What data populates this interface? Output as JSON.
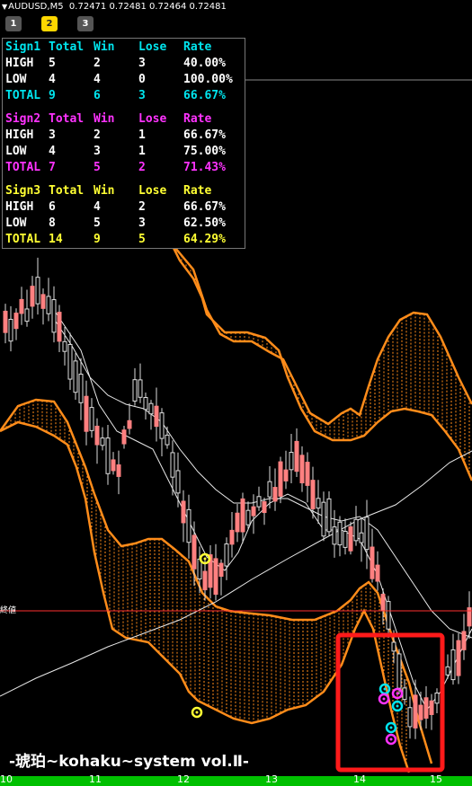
{
  "header": {
    "symbol": "AUDUSD,M5",
    "quotes": "0.72471 0.72481 0.72464 0.72481"
  },
  "tabs": [
    {
      "label": "1",
      "active": false
    },
    {
      "label": "2",
      "active": true
    },
    {
      "label": "3",
      "active": false
    }
  ],
  "stats": {
    "sign1": {
      "header": [
        "Sign1",
        "Total",
        "Win",
        "Lose",
        "Rate"
      ],
      "rows": [
        [
          "HIGH",
          "5",
          "2",
          "3",
          "40.00%"
        ],
        [
          "LOW",
          "4",
          "4",
          "0",
          "100.00%"
        ],
        [
          "TOTAL",
          "9",
          "6",
          "3",
          "66.67%"
        ]
      ]
    },
    "sign2": {
      "header": [
        "Sign2",
        "Total",
        "Win",
        "Lose",
        "Rate"
      ],
      "rows": [
        [
          "HIGH",
          "3",
          "2",
          "1",
          "66.67%"
        ],
        [
          "LOW",
          "4",
          "3",
          "1",
          "75.00%"
        ],
        [
          "TOTAL",
          "7",
          "5",
          "2",
          "71.43%"
        ]
      ]
    },
    "sign3": {
      "header": [
        "Sign3",
        "Total",
        "Win",
        "Lose",
        "Rate"
      ],
      "rows": [
        [
          "HIGH",
          "6",
          "4",
          "2",
          "66.67%"
        ],
        [
          "LOW",
          "8",
          "5",
          "3",
          "62.50%"
        ],
        [
          "TOTAL",
          "14",
          "9",
          "5",
          "64.29%"
        ]
      ]
    }
  },
  "chart": {
    "hline_label": "終値",
    "time_labels": [
      "10",
      "11",
      "12",
      "13",
      "14",
      "15"
    ],
    "watermark": "-琥珀~kohaku~system vol.Ⅱ-"
  },
  "colors": {
    "background": "#000000",
    "band": "#ff8c1a",
    "bull_candle": "#ff8080",
    "bear_candle": "#000000",
    "hline": "#ff3030",
    "highlight_box": "#ff1a1a",
    "sign1": "#00e5ee",
    "sign2": "#ff33ff",
    "sign3": "#ffff33",
    "axis_bar": "#00c000"
  }
}
